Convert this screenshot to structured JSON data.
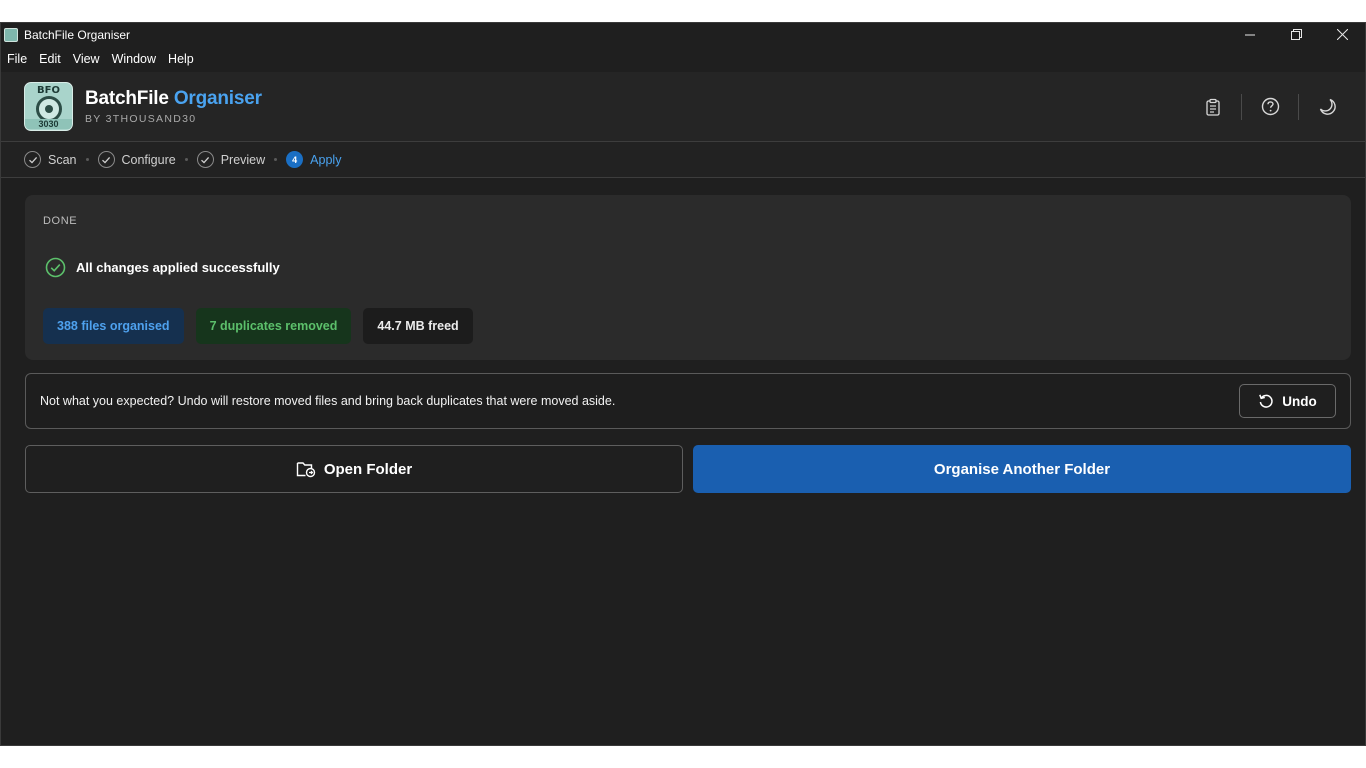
{
  "window": {
    "title": "BatchFile Organiser",
    "minimize_glyph": "–",
    "restore_glyph": "❐",
    "close_glyph": "✕"
  },
  "menu": [
    "File",
    "Edit",
    "View",
    "Window",
    "Help"
  ],
  "header": {
    "logo_top": "BFO",
    "logo_bottom": "3030",
    "brand_main": "BatchFile",
    "brand_accent": "Organiser",
    "by_line": "BY 3THOUSAND30",
    "icons": [
      "clipboard-icon",
      "help-icon",
      "theme-moon-icon"
    ]
  },
  "steps": [
    {
      "label": "Scan",
      "state": "complete"
    },
    {
      "label": "Configure",
      "state": "complete"
    },
    {
      "label": "Preview",
      "state": "complete"
    },
    {
      "label": "Apply",
      "state": "active",
      "number": "4"
    }
  ],
  "result": {
    "section_label": "DONE",
    "message": "All changes applied successfully",
    "badges": {
      "files": "388 files organised",
      "duplicates": "7 duplicates removed",
      "freed": "44.7 MB freed"
    }
  },
  "undo": {
    "message": "Not what you expected? Undo will restore moved files and bring back duplicates that were moved aside.",
    "button_label": "Undo"
  },
  "actions": {
    "open_folder": "Open Folder",
    "organise_another": "Organise Another Folder"
  },
  "colors": {
    "accent": "#4aa3f0",
    "primary_button": "#1a5fb0",
    "success": "#5cc06b",
    "background": "#1f1f1f"
  }
}
